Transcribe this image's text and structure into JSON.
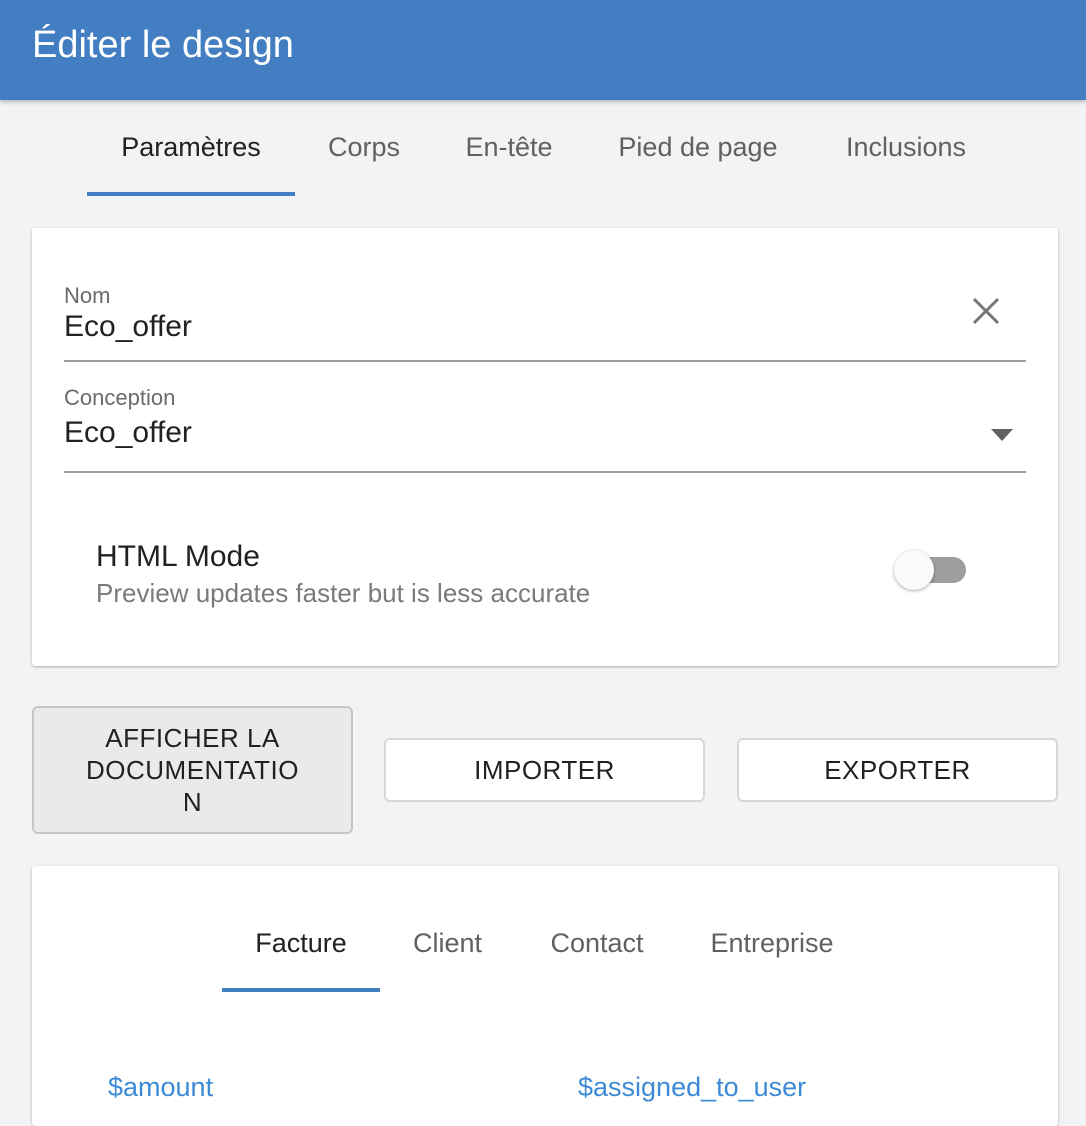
{
  "appbar": {
    "title": "Éditer le design"
  },
  "tabs": [
    {
      "label": "Paramètres",
      "active": true
    },
    {
      "label": "Corps"
    },
    {
      "label": "En-tête"
    },
    {
      "label": "Pied de page"
    },
    {
      "label": "Inclusions"
    }
  ],
  "settings": {
    "name_field": {
      "label": "Nom",
      "value": "Eco_offer"
    },
    "design_field": {
      "label": "Conception",
      "value": "Eco_offer"
    },
    "html_mode": {
      "title": "HTML Mode",
      "subtitle": "Preview updates faster but is less accurate",
      "enabled": false
    }
  },
  "actions": {
    "docs_line1": "AFFICHER LA",
    "docs_line2": "DOCUMENTATIO",
    "docs_line3": "N",
    "import_label": "IMPORTER",
    "export_label": "EXPORTER"
  },
  "variables": {
    "tabs": [
      {
        "label": "Facture",
        "active": true
      },
      {
        "label": "Client"
      },
      {
        "label": "Contact"
      },
      {
        "label": "Entreprise"
      }
    ],
    "items": [
      "$amount",
      "$assigned_to_user"
    ]
  },
  "colors": {
    "primary": "#427ec1",
    "link": "#3d8bd6",
    "background": "#f2f3f5"
  }
}
